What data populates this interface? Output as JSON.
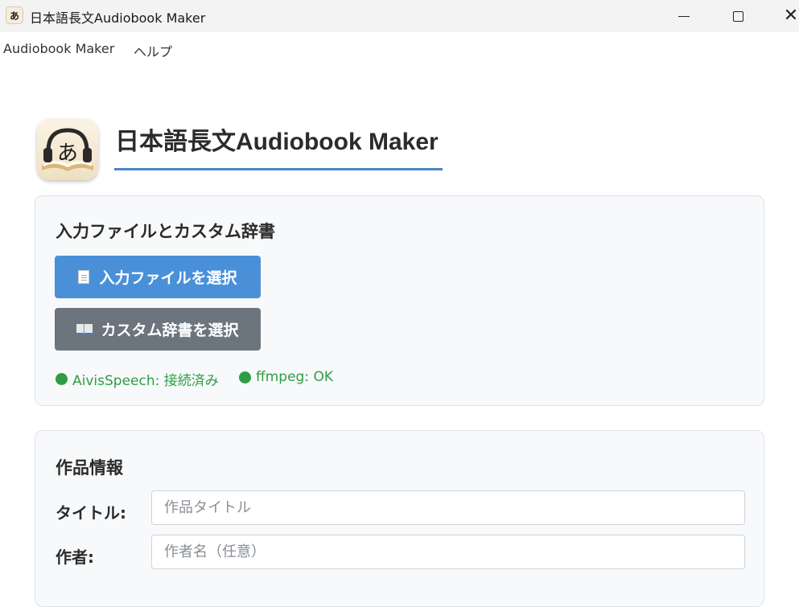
{
  "window": {
    "title": "日本語長文Audiobook Maker",
    "icon_glyph": "あ",
    "controls": [
      "minimize-icon",
      "maximize-icon",
      "close-icon"
    ]
  },
  "menu": {
    "items": [
      "Audiobook Maker",
      "ヘルプ"
    ]
  },
  "header": {
    "title": "日本語長文Audiobook Maker",
    "logo_glyph": "あ",
    "accent_color": "#4a86c8"
  },
  "files_section": {
    "heading": "入力ファイルとカスタム辞書",
    "select_input_button": "入力ファイルを選択",
    "select_dict_button": "カスタム辞書を選択",
    "status": [
      {
        "label": "AivisSpeech: 接続済み",
        "color": "#2e9e44"
      },
      {
        "label": "ffmpeg: OK",
        "color": "#2e9e44"
      }
    ]
  },
  "info_section": {
    "heading": "作品情報",
    "title_label": "タイトル:",
    "title_placeholder": "作品タイトル",
    "title_value": "",
    "author_label": "作者:",
    "author_placeholder": "作者名（任意）",
    "author_value": ""
  }
}
